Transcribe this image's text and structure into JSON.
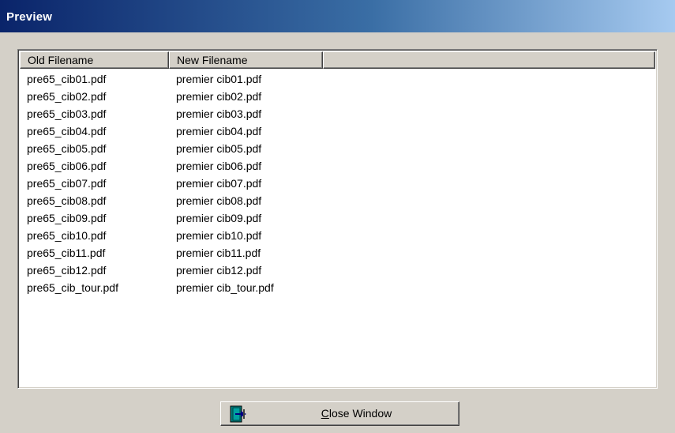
{
  "window": {
    "title": "Preview"
  },
  "list": {
    "columns": [
      "Old Filename",
      "New Filename"
    ],
    "rows": [
      {
        "old": "pre65_cib01.pdf",
        "new": "premier cib01.pdf"
      },
      {
        "old": "pre65_cib02.pdf",
        "new": "premier cib02.pdf"
      },
      {
        "old": "pre65_cib03.pdf",
        "new": "premier cib03.pdf"
      },
      {
        "old": "pre65_cib04.pdf",
        "new": "premier cib04.pdf"
      },
      {
        "old": "pre65_cib05.pdf",
        "new": "premier cib05.pdf"
      },
      {
        "old": "pre65_cib06.pdf",
        "new": "premier cib06.pdf"
      },
      {
        "old": "pre65_cib07.pdf",
        "new": "premier cib07.pdf"
      },
      {
        "old": "pre65_cib08.pdf",
        "new": "premier cib08.pdf"
      },
      {
        "old": "pre65_cib09.pdf",
        "new": "premier cib09.pdf"
      },
      {
        "old": "pre65_cib10.pdf",
        "new": "premier cib10.pdf"
      },
      {
        "old": "pre65_cib11.pdf",
        "new": "premier cib11.pdf"
      },
      {
        "old": "pre65_cib12.pdf",
        "new": "premier cib12.pdf"
      },
      {
        "old": "pre65_cib_tour.pdf",
        "new": "premier cib_tour.pdf"
      }
    ]
  },
  "close_button": {
    "mnemonic": "C",
    "label_rest": "lose Window",
    "icon": "exit-door-icon"
  },
  "colors": {
    "title_gradient_start": "#0a246a",
    "title_gradient_end": "#a6caf0",
    "face": "#d4d0c8",
    "list_background": "#ffffff"
  }
}
